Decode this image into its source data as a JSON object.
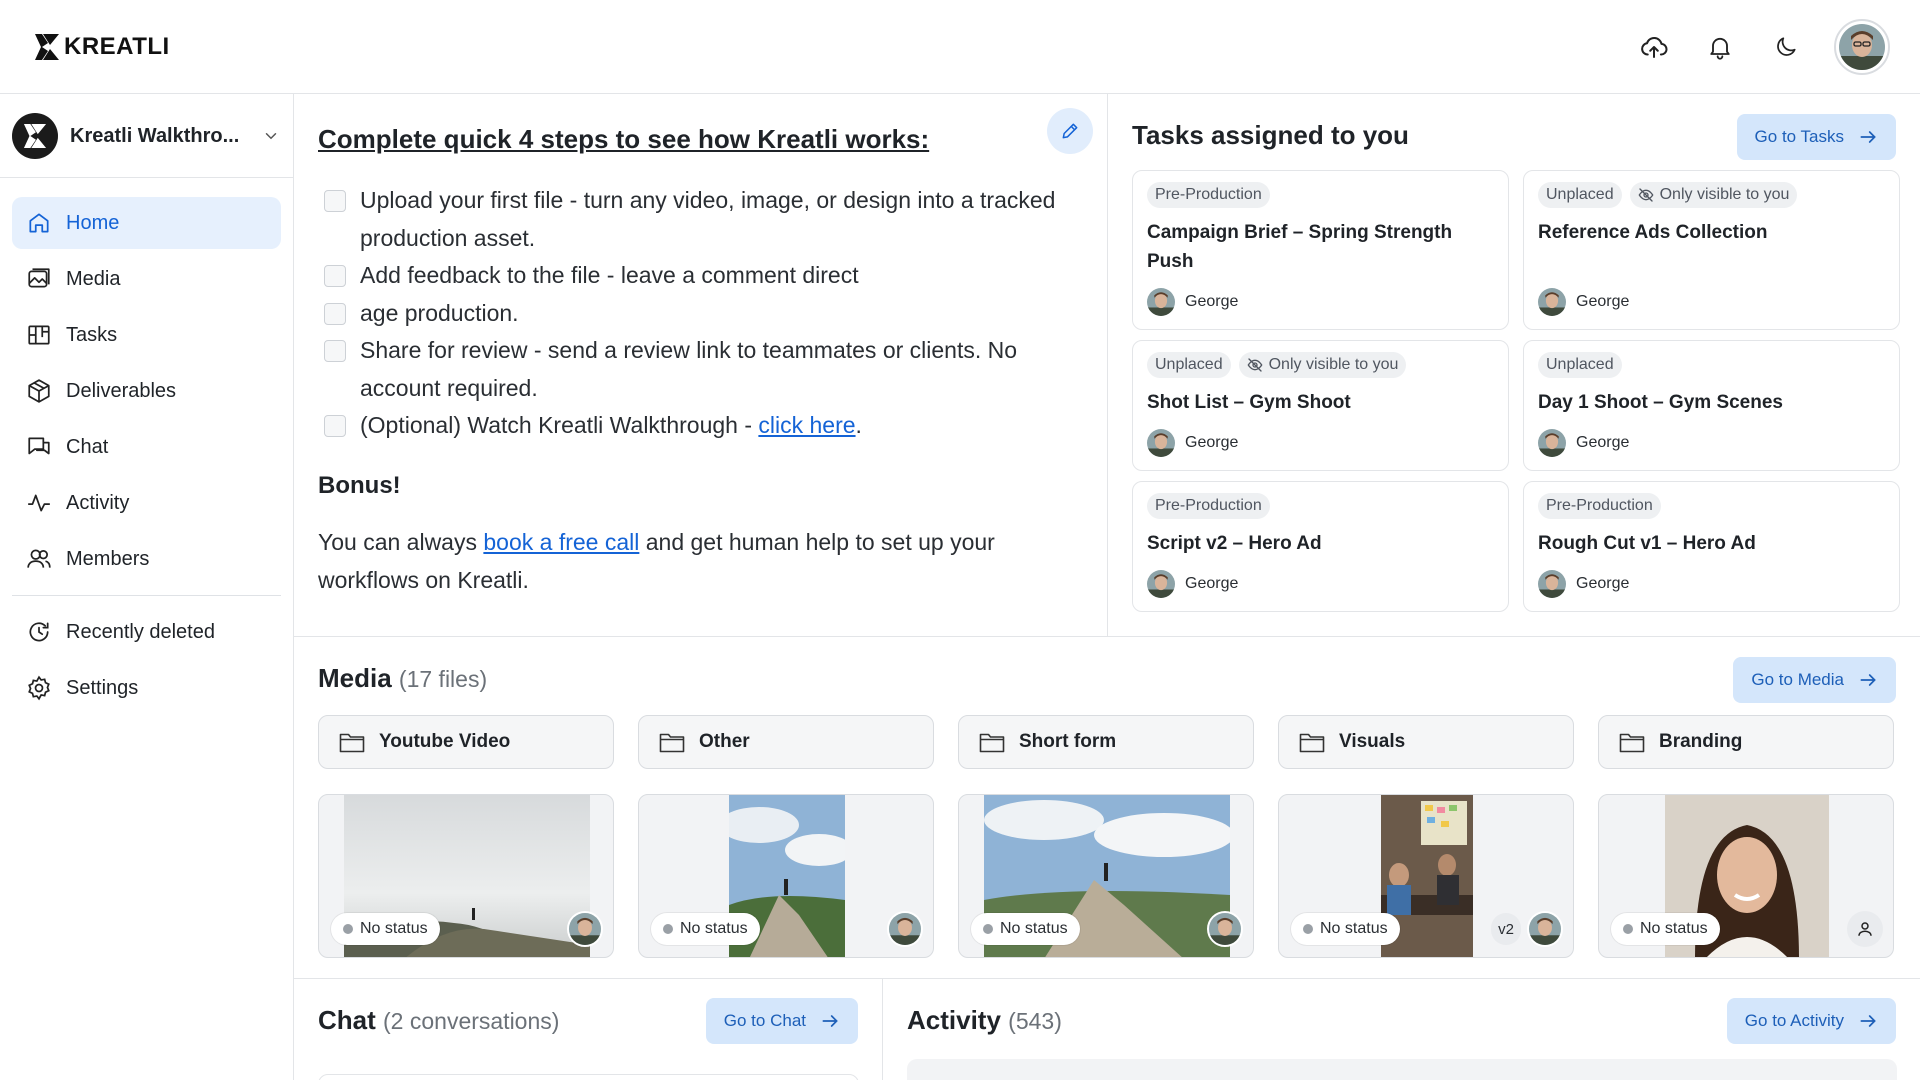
{
  "brand": {
    "name": "KREATLI"
  },
  "topbar": {
    "icons": [
      "cloud-upload-icon",
      "bell-icon",
      "moon-icon"
    ]
  },
  "sidebar": {
    "workspace_name": "Kreatli Walkthro...",
    "items": [
      {
        "label": "Home",
        "icon": "home-icon",
        "active": true
      },
      {
        "label": "Media",
        "icon": "media-icon"
      },
      {
        "label": "Tasks",
        "icon": "tasks-board-icon"
      },
      {
        "label": "Deliverables",
        "icon": "box-icon"
      },
      {
        "label": "Chat",
        "icon": "chat-icon"
      },
      {
        "label": "Activity",
        "icon": "activity-icon"
      },
      {
        "label": "Members",
        "icon": "members-icon"
      }
    ],
    "secondary_items": [
      {
        "label": "Recently deleted",
        "icon": "history-icon"
      },
      {
        "label": "Settings",
        "icon": "gear-icon"
      }
    ]
  },
  "onboarding": {
    "title": "Complete quick 4 steps to see how Kreatli works:",
    "steps": [
      "Upload your first file - turn any video, image, or design into a tracked production asset.",
      "Add feedback to the file - leave a comment direct",
      "age production.",
      "Share for review - send a review link to teammates or clients. No account required."
    ],
    "optional_step_prefix": "(Optional) Watch Kreatli Walkthrough - ",
    "optional_step_link": "click here",
    "optional_step_suffix": ".",
    "bonus_title": "Bonus!",
    "bonus_prefix": "You can always ",
    "bonus_link": "book a free call",
    "bonus_suffix": " and get human help to set up your workflows on Kreatli."
  },
  "tasks": {
    "title": "Tasks assigned to you",
    "button": "Go to Tasks",
    "cards": [
      {
        "tags": [
          "Pre-Production"
        ],
        "private": false,
        "title": "Campaign Brief – Spring Strength Push",
        "assignee": "George"
      },
      {
        "tags": [
          "Unplaced"
        ],
        "private": true,
        "private_label": "Only visible to you",
        "title": "Reference Ads Collection",
        "assignee": "George"
      },
      {
        "tags": [
          "Unplaced"
        ],
        "private": true,
        "private_label": "Only visible to you",
        "title": "Shot List – Gym Shoot",
        "assignee": "George"
      },
      {
        "tags": [
          "Unplaced"
        ],
        "private": false,
        "title": "Day 1 Shoot – Gym Scenes",
        "assignee": "George"
      },
      {
        "tags": [
          "Pre-Production"
        ],
        "private": false,
        "title": "Script v2 – Hero Ad",
        "assignee": "George"
      },
      {
        "tags": [
          "Pre-Production"
        ],
        "private": false,
        "title": "Rough Cut v1 – Hero Ad",
        "assignee": "George"
      }
    ]
  },
  "media": {
    "title": "Media",
    "count": "(17 files)",
    "button": "Go to Media",
    "folders": [
      "Youtube Video",
      "Other",
      "Short form",
      "Visuals",
      "Branding"
    ],
    "files": [
      {
        "status": "No status",
        "scene": "foggy-mountain",
        "version": ""
      },
      {
        "status": "No status",
        "scene": "mountain-hiker",
        "version": ""
      },
      {
        "status": "No status",
        "scene": "mountain-hiker-wide",
        "version": ""
      },
      {
        "status": "No status",
        "scene": "office-meeting",
        "version": "v2"
      },
      {
        "status": "No status",
        "scene": "portrait-woman",
        "version": ""
      }
    ]
  },
  "chat": {
    "title": "Chat",
    "count": "(2 conversations)",
    "button": "Go to Chat"
  },
  "activity": {
    "title": "Activity",
    "count": "(543)",
    "button": "Go to Activity"
  },
  "colors": {
    "accent": "#1463d6",
    "accent_bg": "#e6f0fd",
    "button_bg": "#d4e6fb"
  }
}
